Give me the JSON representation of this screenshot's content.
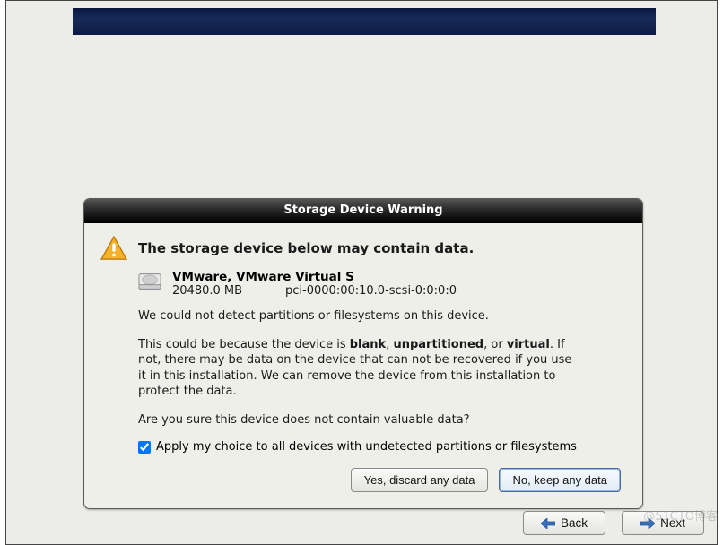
{
  "dialog": {
    "title": "Storage Device Warning",
    "heading": "The storage device below may contain data.",
    "device": {
      "name": "VMware, VMware Virtual S",
      "size": "20480.0 MB",
      "path": "pci-0000:00:10.0-scsi-0:0:0:0"
    },
    "para1": "We could not detect partitions or filesystems on this device.",
    "para2_a": "This could be because the device is ",
    "para2_blank": "blank",
    "para2_sep1": ", ",
    "para2_unpart": "unpartitioned",
    "para2_sep2": ", or ",
    "para2_virtual": "virtual",
    "para2_b": ". If not, there may be data on the device that can not be recovered if you use it in this installation. We can remove the device from this installation to protect the data.",
    "para3": "Are you sure this device does not contain valuable data?",
    "apply_all_label": "Apply my choice to all devices with undetected partitions or filesystems",
    "apply_all_checked": true,
    "yes_label": "Yes, discard any data",
    "no_label": "No, keep any data"
  },
  "nav": {
    "back": "Back",
    "next": "Next"
  },
  "watermark": "@51CTO博客"
}
